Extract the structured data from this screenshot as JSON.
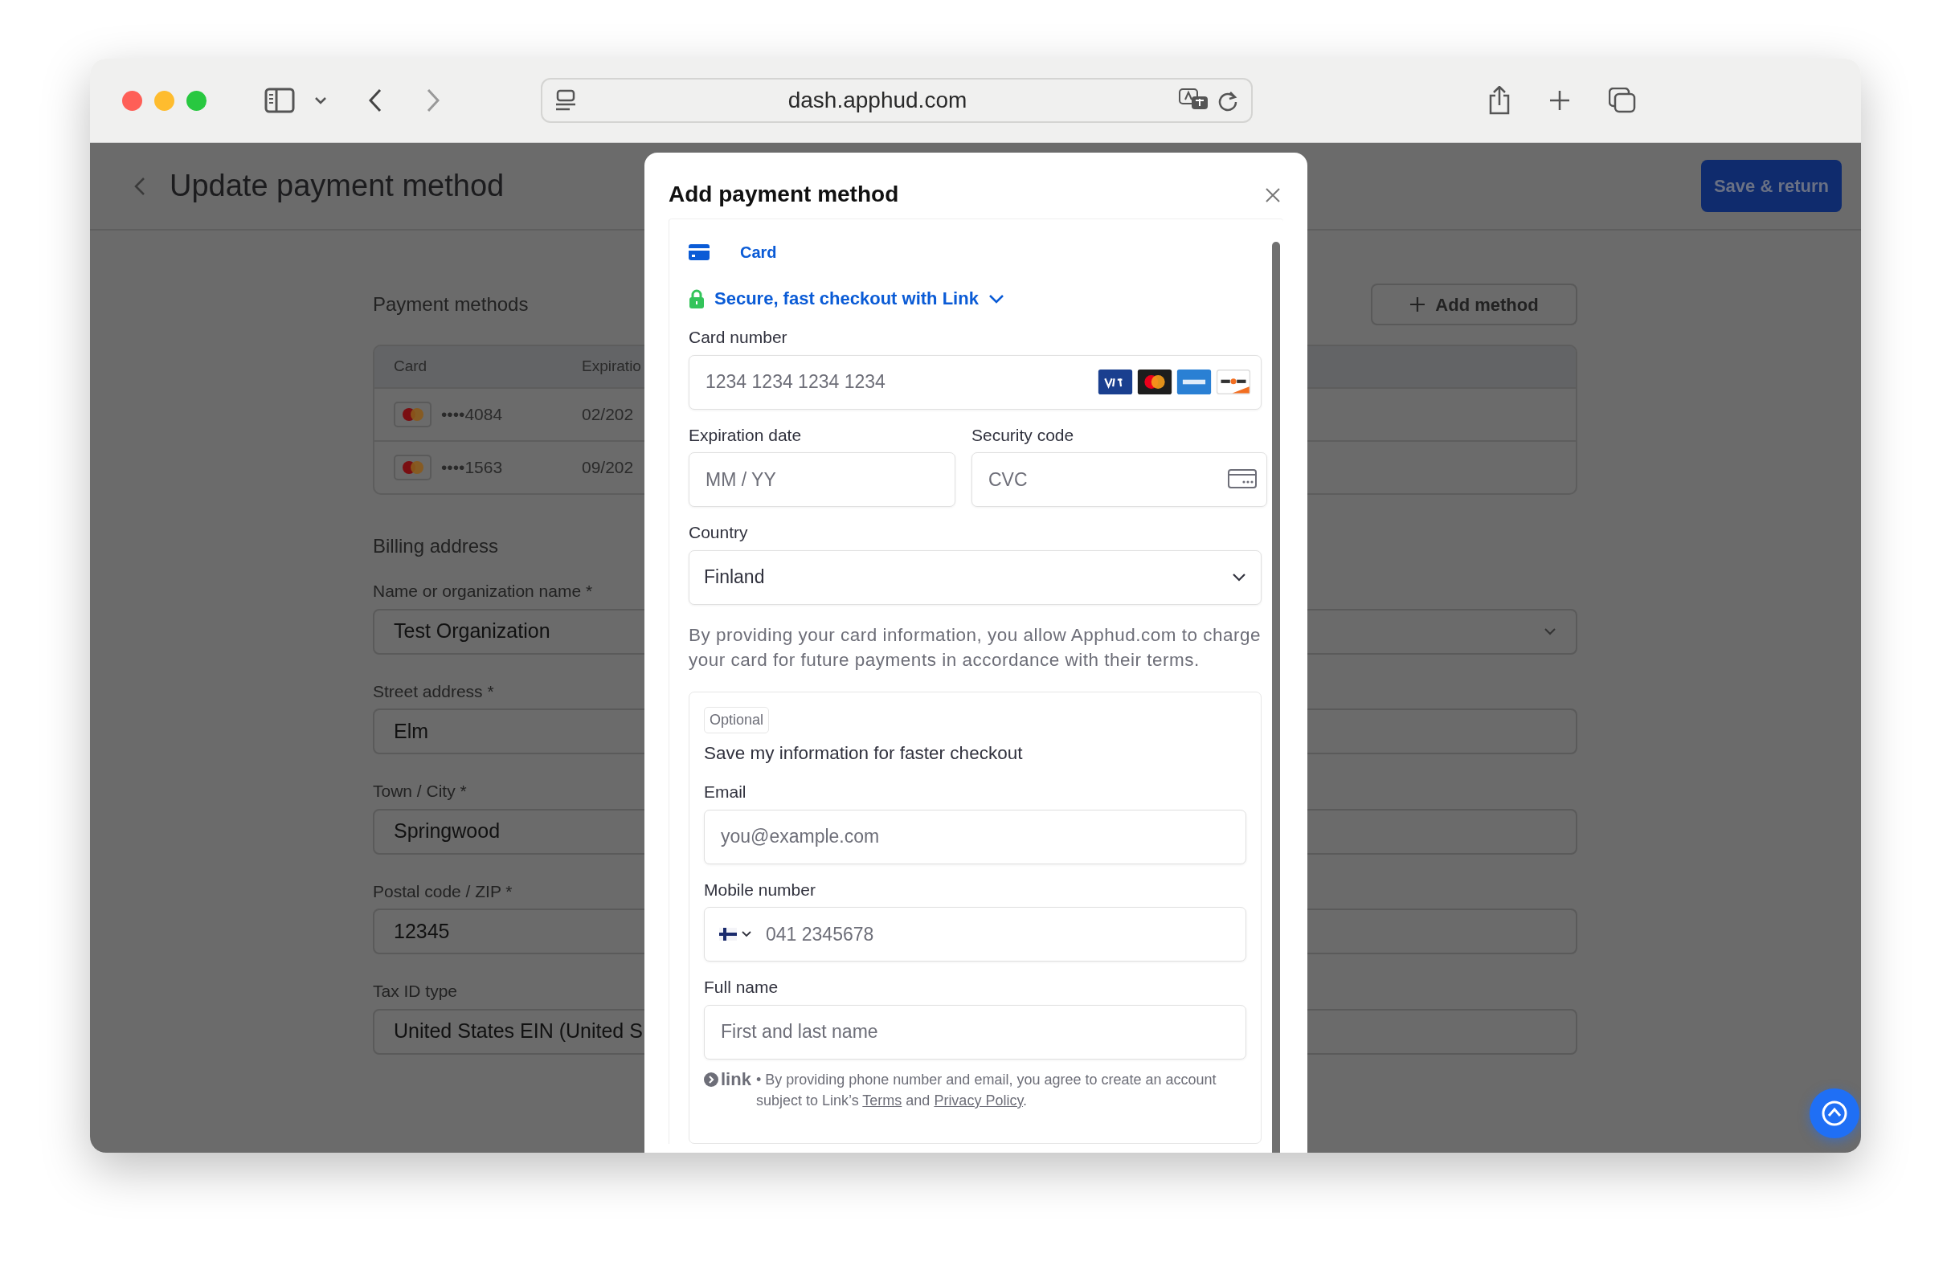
{
  "browser": {
    "url": "dash.apphud.com"
  },
  "page": {
    "title": "Update payment method",
    "save_button": "Save & return",
    "payment_methods": {
      "heading": "Payment methods",
      "add_button": "Add method",
      "columns": [
        "Card",
        "Expiratio"
      ],
      "rows": [
        {
          "card": "••••4084",
          "expiration": "02/202"
        },
        {
          "card": "••••1563",
          "expiration": "09/202"
        }
      ]
    },
    "billing": {
      "heading": "Billing address",
      "fields": [
        {
          "label": "Name or organization name *",
          "value": "Test Organization",
          "kind": "select"
        },
        {
          "label": "Street address *",
          "value": "Elm",
          "kind": "text"
        },
        {
          "label": "Town / City *",
          "value": "Springwood",
          "kind": "text"
        },
        {
          "label": "Postal code / ZIP *",
          "value": "12345",
          "kind": "text"
        },
        {
          "label": "Tax ID type",
          "value": "United States EIN (United S",
          "kind": "text"
        }
      ]
    }
  },
  "modal": {
    "title": "Add payment method",
    "tab": "Card",
    "link_prompt": "Secure, fast checkout with Link",
    "card_number": {
      "label": "Card number",
      "placeholder": "1234 1234 1234 1234"
    },
    "expiration": {
      "label": "Expiration date",
      "placeholder": "MM / YY"
    },
    "security_code": {
      "label": "Security code",
      "placeholder": "CVC"
    },
    "country": {
      "label": "Country",
      "value": "Finland"
    },
    "consent": "By providing your card information, you allow Apphud.com to charge your card for future payments in accordance with their terms.",
    "save_info": {
      "badge": "Optional",
      "heading": "Save my information for faster checkout",
      "email": {
        "label": "Email",
        "placeholder": "you@example.com"
      },
      "mobile": {
        "label": "Mobile number",
        "placeholder": "041 2345678"
      },
      "full_name": {
        "label": "Full name",
        "placeholder": "First and last name"
      },
      "footer": {
        "logo": "link",
        "before": "• By providing phone number and email, you agree to create an account subject to Link’s ",
        "terms": "Terms",
        "middle": " and ",
        "privacy": "Privacy Policy",
        "end": "."
      }
    }
  }
}
